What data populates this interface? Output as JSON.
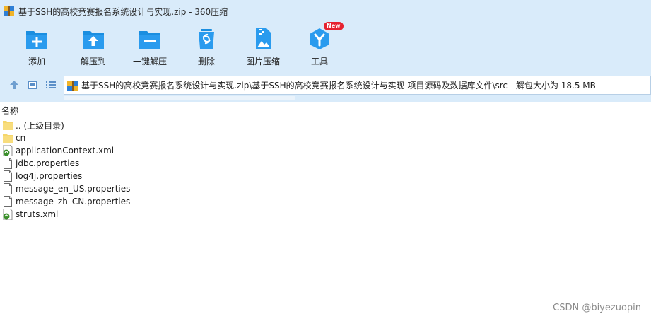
{
  "window": {
    "title": "基于SSH的高校竞赛报名系统设计与实现.zip - 360压缩"
  },
  "toolbar": {
    "items": [
      {
        "label": "添加",
        "icon": "add-icon"
      },
      {
        "label": "解压到",
        "icon": "extract-to-icon"
      },
      {
        "label": "一键解压",
        "icon": "one-click-extract-icon"
      },
      {
        "label": "删除",
        "icon": "delete-icon"
      },
      {
        "label": "图片压缩",
        "icon": "image-compress-icon"
      },
      {
        "label": "工具",
        "icon": "tools-icon",
        "badge": "New"
      }
    ]
  },
  "address": {
    "path": "基于SSH的高校竞赛报名系统设计与实现.zip\\基于SSH的高校竞赛报名系统设计与实现 项目源码及数据库文件\\src - 解包大小为 18.5 MB"
  },
  "list": {
    "column_name": "名称",
    "files": [
      {
        "name": ".. (上级目录)",
        "type": "folder"
      },
      {
        "name": "cn",
        "type": "folder"
      },
      {
        "name": "applicationContext.xml",
        "type": "xml"
      },
      {
        "name": "jdbc.properties",
        "type": "file"
      },
      {
        "name": "log4j.properties",
        "type": "file"
      },
      {
        "name": "message_en_US.properties",
        "type": "file"
      },
      {
        "name": "message_zh_CN.properties",
        "type": "file"
      },
      {
        "name": "struts.xml",
        "type": "xml"
      }
    ]
  },
  "watermark": "CSDN @biyezuopin",
  "colors": {
    "chrome_bg": "#d9ebfa",
    "icon_blue": "#1a8ee0",
    "badge_red": "#e6222f",
    "folder_yellow": "#f5d66b"
  }
}
